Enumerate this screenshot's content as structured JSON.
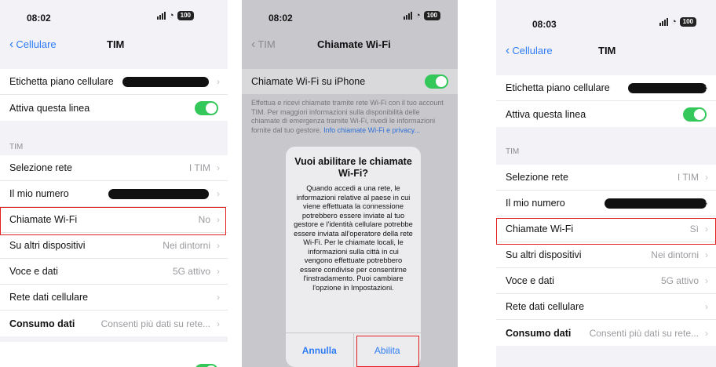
{
  "screen1": {
    "time": "08:02",
    "battery": "100",
    "back_label": "Cellulare",
    "title": "TIM",
    "rows_top": [
      {
        "label": "Etichetta piano cellulare"
      },
      {
        "label": "Attiva questa linea"
      }
    ],
    "section_header": "TIM",
    "rows": [
      {
        "label": "Selezione rete",
        "value": "I TIM"
      },
      {
        "label": "Il mio numero",
        "value": ""
      },
      {
        "label": "Chiamate Wi-Fi",
        "value": "No"
      },
      {
        "label": "Su altri dispositivi",
        "value": "Nei dintorni"
      },
      {
        "label": "Voce e dati",
        "value": "5G attivo"
      },
      {
        "label": "Rete dati cellulare",
        "value": ""
      },
      {
        "label": "Consumo dati",
        "value": "Consenti più dati su rete..."
      }
    ]
  },
  "screen2": {
    "time": "08:02",
    "battery": "100",
    "back_label": "TIM",
    "title": "Chiamate Wi-Fi",
    "wifi_row_label": "Chiamate Wi-Fi su iPhone",
    "description": "Effettua e ricevi chiamate tramite rete Wi-Fi con il tuo account TIM. Per maggiori informazioni sulla disponibilità delle chiamate di emergenza tramite Wi-Fi, rivedi le informazioni fornite dal tuo gestore.",
    "description_link": "Info chiamate Wi-Fi e privacy...",
    "dialog": {
      "title": "Vuoi abilitare le chiamate Wi-Fi?",
      "message": "Quando accedi a una rete, le informazioni relative al paese in cui viene effettuata la connessione potrebbero essere inviate al tuo gestore e l'identità cellulare potrebbe essere inviata all'operatore della rete Wi-Fi. Per le chiamate locali, le informazioni sulla città in cui vengono effettuate potrebbero essere condivise per consentirne l'instradamento. Puoi cambiare l'opzione in Impostazioni.",
      "cancel_label": "Annulla",
      "confirm_label": "Abilita"
    }
  },
  "screen3": {
    "time": "08:03",
    "battery": "100",
    "back_label": "Cellulare",
    "title": "TIM",
    "rows_top": [
      {
        "label": "Etichetta piano cellulare"
      },
      {
        "label": "Attiva questa linea"
      }
    ],
    "section_header": "TIM",
    "rows": [
      {
        "label": "Selezione rete",
        "value": "I TIM"
      },
      {
        "label": "Il mio numero",
        "value": ""
      },
      {
        "label": "Chiamate Wi-Fi",
        "value": "Sì"
      },
      {
        "label": "Su altri dispositivi",
        "value": "Nei dintorni"
      },
      {
        "label": "Voce e dati",
        "value": "5G attivo"
      },
      {
        "label": "Rete dati cellulare",
        "value": ""
      },
      {
        "label": "Consumo dati",
        "value": "Consenti più dati su rete..."
      }
    ]
  },
  "colors": {
    "accent": "#2f7cf6",
    "toggle_on": "#34c759",
    "highlight": "#e02020"
  }
}
